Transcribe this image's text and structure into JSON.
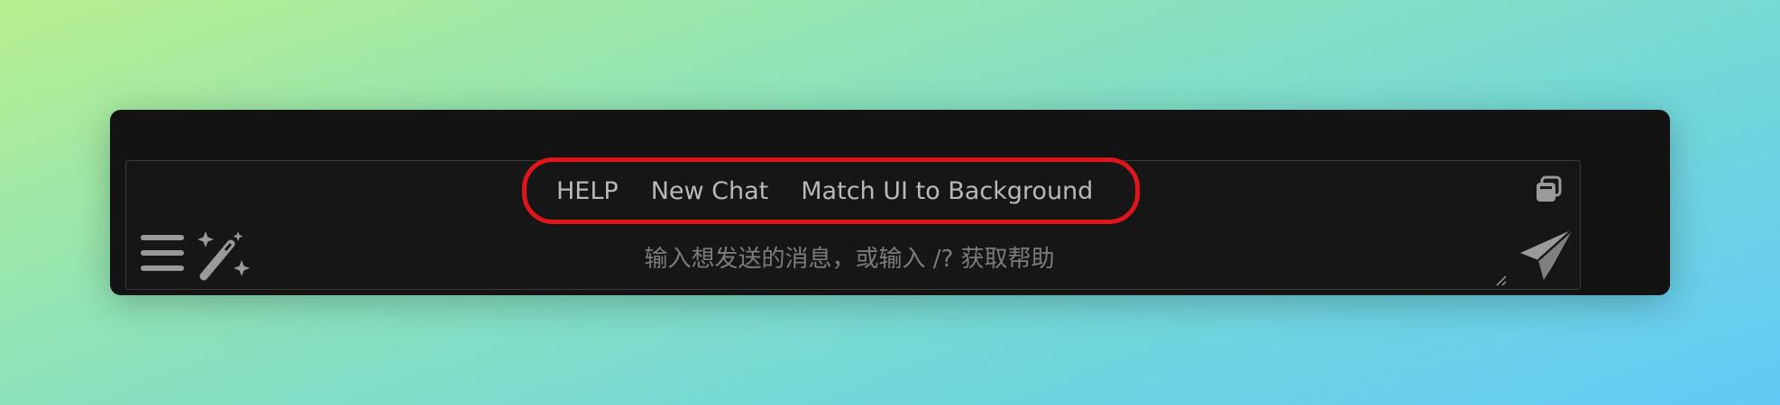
{
  "quick_actions": {
    "items": [
      {
        "label": "HELP"
      },
      {
        "label": "New Chat"
      },
      {
        "label": "Match UI to Background"
      }
    ],
    "highlight_color": "#e0141b"
  },
  "input": {
    "placeholder": "输入想发送的消息，或输入 /? 获取帮助",
    "value": ""
  },
  "icons": {
    "copy": "copy-icon",
    "menu": "hamburger-menu-icon",
    "magic": "magic-wand-icon",
    "send": "paper-plane-icon",
    "resize": "resize-handle-icon"
  },
  "colors": {
    "panel_bg": "#131313",
    "text": "#b9b9b9",
    "icon": "#9a9a9a",
    "placeholder": "#7c7c7c"
  }
}
